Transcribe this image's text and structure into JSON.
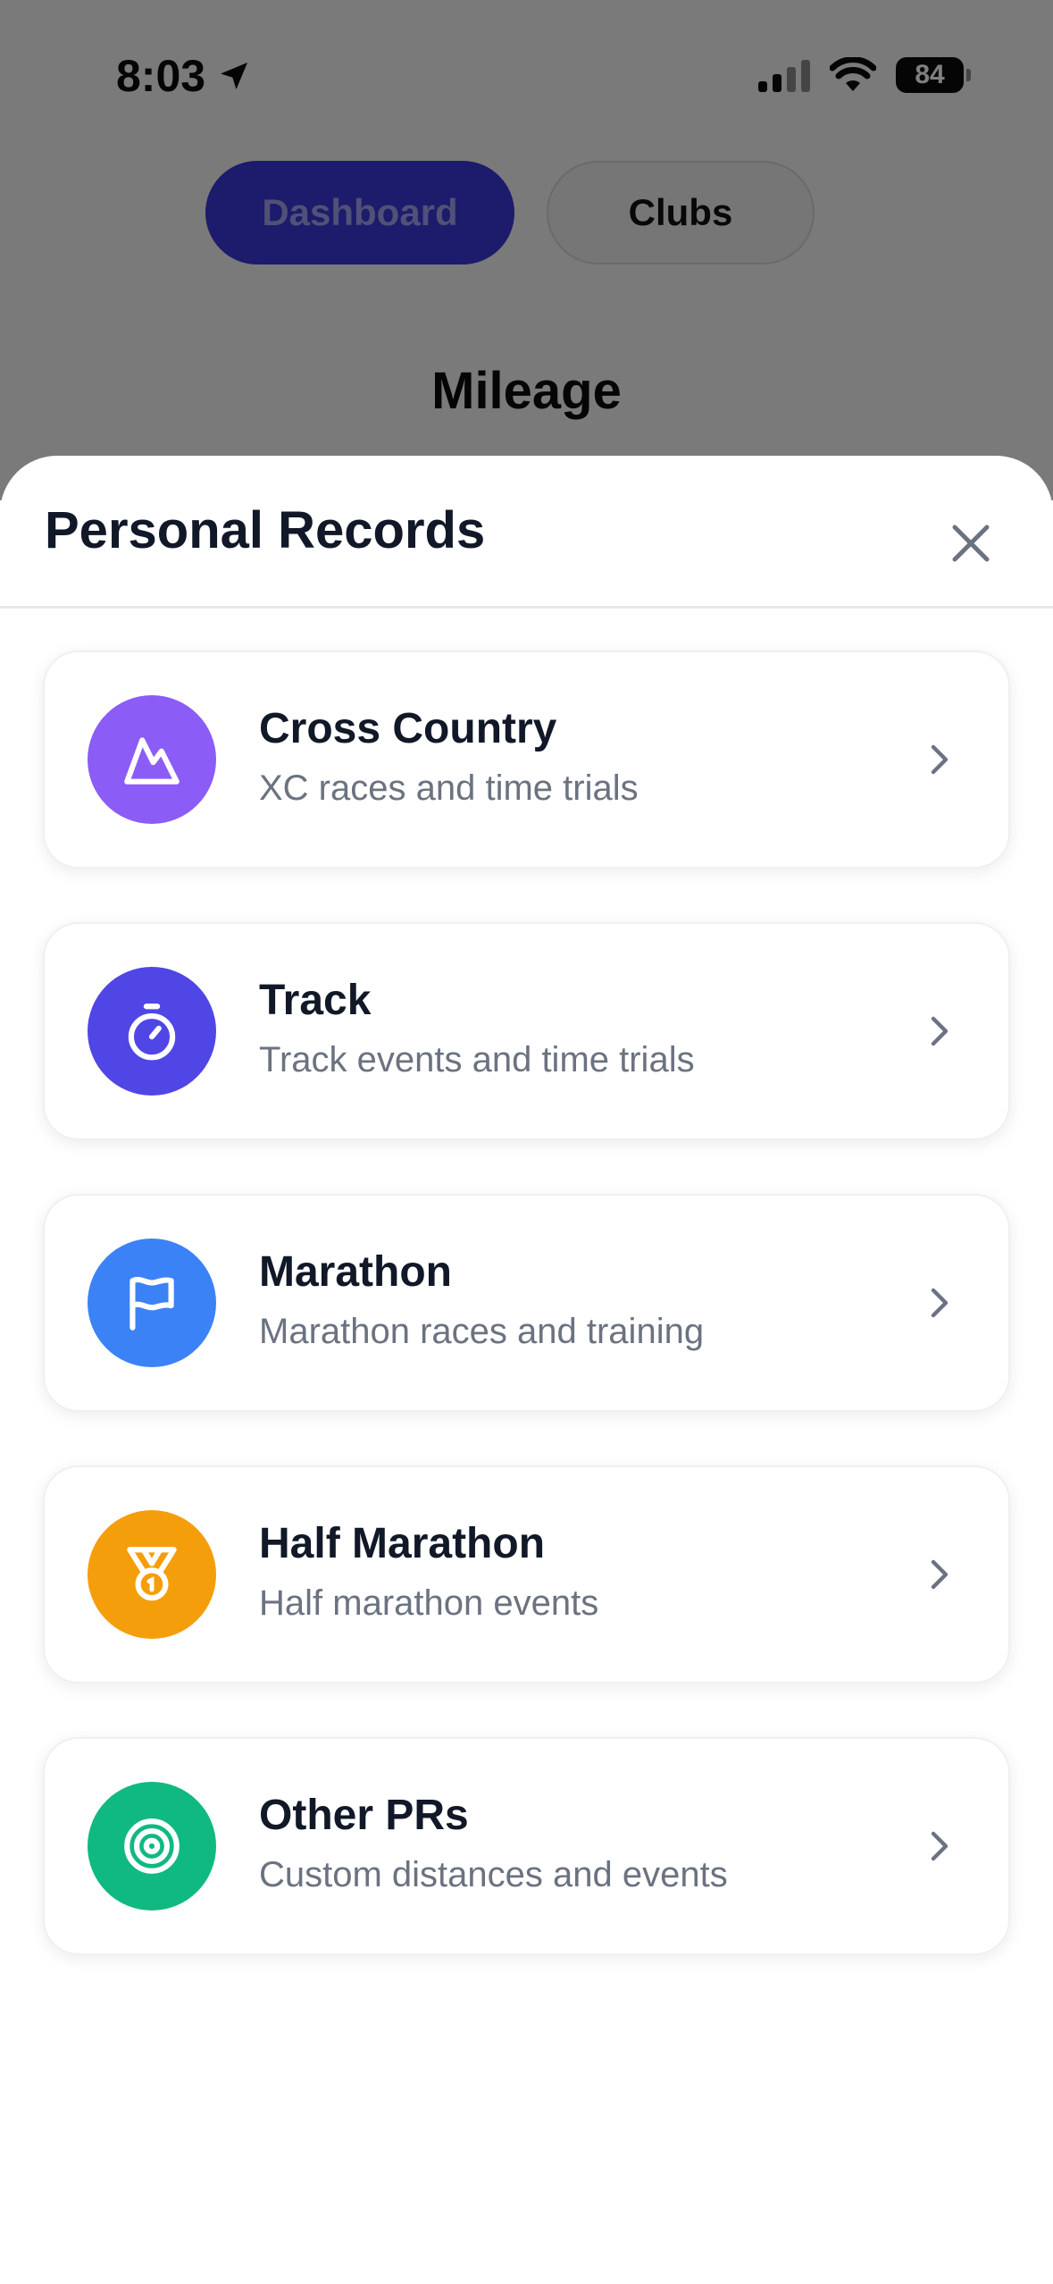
{
  "status_bar": {
    "time": "8:03",
    "battery": "84"
  },
  "background": {
    "tabs": [
      {
        "label": "Dashboard",
        "active": true
      },
      {
        "label": "Clubs",
        "active": false
      }
    ],
    "section_title": "Mileage"
  },
  "sheet": {
    "title": "Personal Records",
    "items": [
      {
        "title": "Cross Country",
        "subtitle": "XC races and time trials",
        "icon": "mountain-icon",
        "color": "#8b5cf6"
      },
      {
        "title": "Track",
        "subtitle": "Track events and time trials",
        "icon": "stopwatch-icon",
        "color": "#4f46e5"
      },
      {
        "title": "Marathon",
        "subtitle": "Marathon races and training",
        "icon": "flag-icon",
        "color": "#3b82f6"
      },
      {
        "title": "Half Marathon",
        "subtitle": "Half marathon events",
        "icon": "medal-icon",
        "color": "#f59e0b"
      },
      {
        "title": "Other PRs",
        "subtitle": "Custom distances and events",
        "icon": "target-icon",
        "color": "#10b981"
      }
    ]
  },
  "colors": {
    "accent": "#3b36d8",
    "text_primary": "#111827",
    "text_secondary": "#6b7280"
  }
}
